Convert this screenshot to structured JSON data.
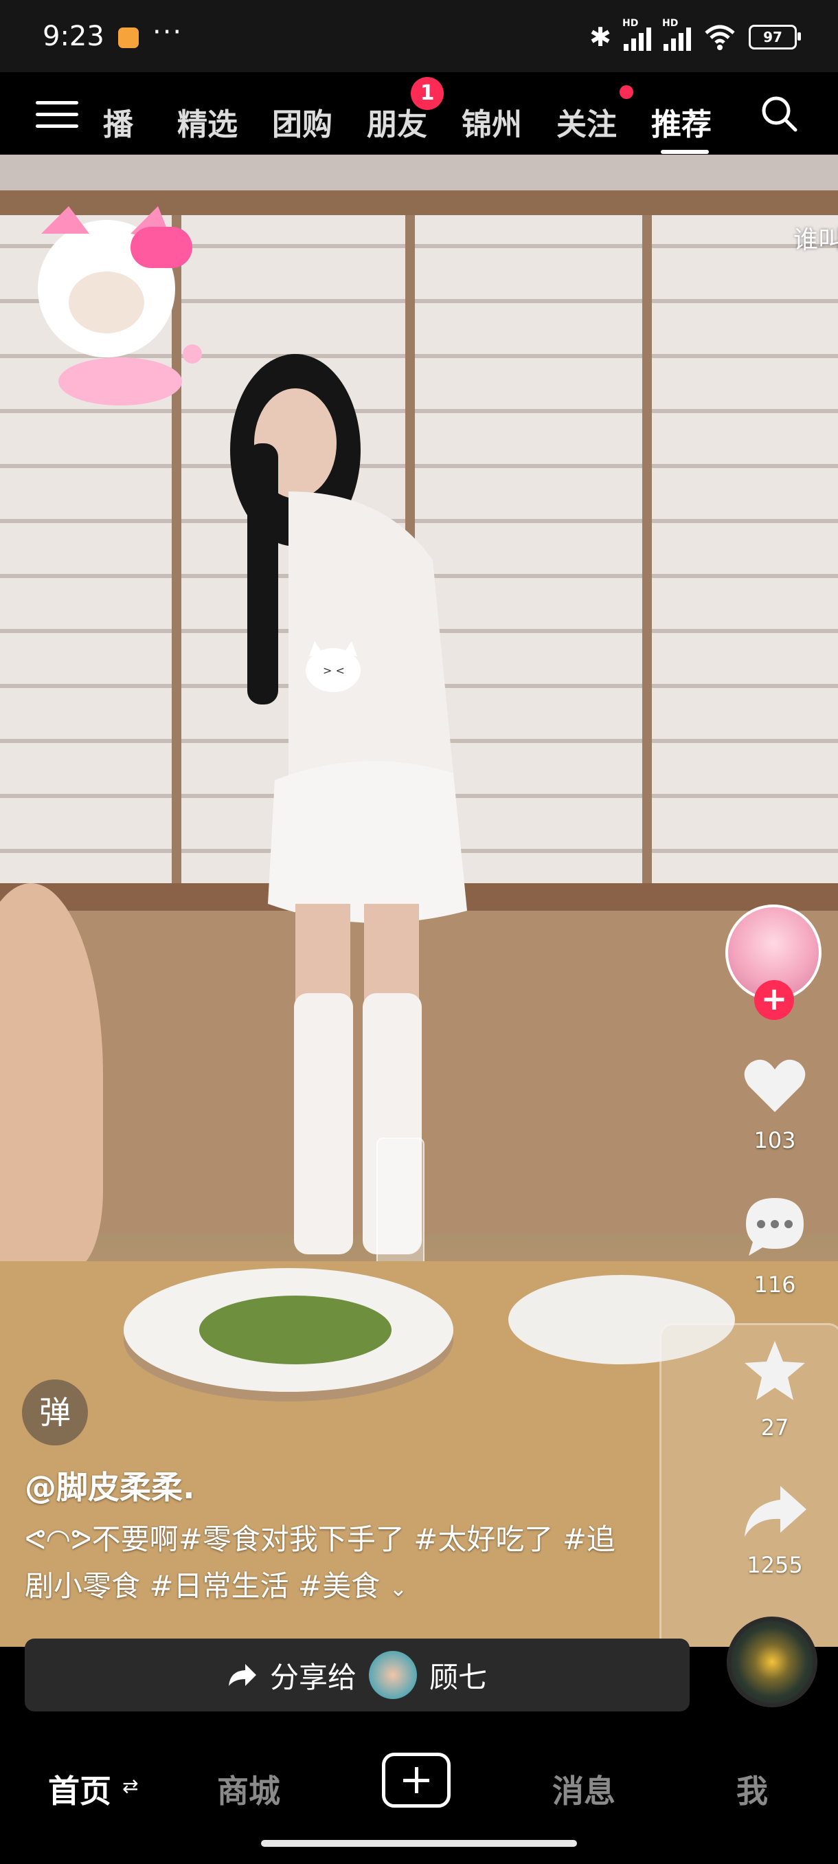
{
  "status_bar": {
    "time": "9:23",
    "more": "···",
    "network_tag": "HD",
    "battery": "97"
  },
  "top_nav": {
    "tabs": [
      {
        "label": "直播",
        "display": "播"
      },
      {
        "label": "精选",
        "display": "精选"
      },
      {
        "label": "团购",
        "display": "团购"
      },
      {
        "label": "朋友",
        "display": "朋友"
      },
      {
        "label": "锦州",
        "display": "锦州"
      },
      {
        "label": "关注",
        "display": "关注"
      },
      {
        "label": "推荐",
        "display": "推荐",
        "active": true
      }
    ],
    "friends_badge": "1",
    "icons": [
      "menu-icon",
      "search-icon"
    ]
  },
  "video": {
    "danmu_partial": "谁叫"
  },
  "right_rail": {
    "follow": "+",
    "likes": "103",
    "comments": "116",
    "favorites": "27",
    "shares": "1255",
    "icons": [
      "heart-icon",
      "comment-icon",
      "star-icon",
      "share-icon"
    ]
  },
  "post": {
    "danmu_button": "弹",
    "username": "@脚皮柔柔.",
    "caption": "ᕙ◠ᕗ不要啊#零食对我下手了 #太好吃了 #追剧小零食 #日常生活 #美食",
    "expand": "⌄"
  },
  "share_bar": {
    "label": "分享给",
    "name": "顾七"
  },
  "bottom_nav": {
    "home": "首页",
    "home_swap": "⇄",
    "mall": "商城",
    "messages": "消息",
    "me": "我"
  },
  "colors": {
    "accent": "#fe2c55",
    "background": "#000000",
    "inactive": "#8a8a8a"
  }
}
